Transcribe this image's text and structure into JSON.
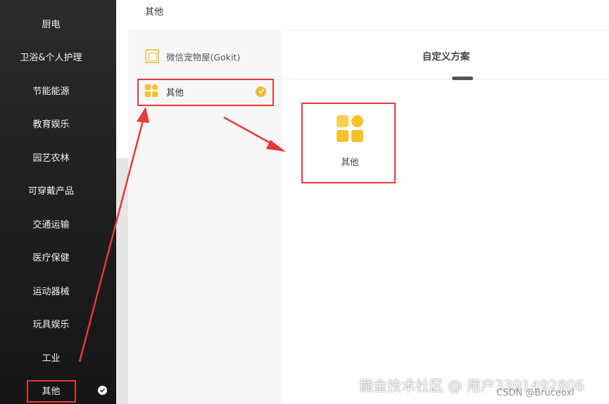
{
  "categories": {
    "items": [
      {
        "label": "厨电"
      },
      {
        "label": "卫浴&个人护理"
      },
      {
        "label": "节能能源"
      },
      {
        "label": "教育娱乐"
      },
      {
        "label": "园艺农林"
      },
      {
        "label": "可穿戴产品"
      },
      {
        "label": "交通运输"
      },
      {
        "label": "医疗保健"
      },
      {
        "label": "运动器械"
      },
      {
        "label": "玩具娱乐"
      },
      {
        "label": "工业"
      },
      {
        "label": "其他",
        "selected": true
      }
    ]
  },
  "header": {
    "title": "其他"
  },
  "products": [
    {
      "label": "微信宠物屋(Gokit)",
      "icon": "device-frame-icon"
    },
    {
      "label": "其他",
      "icon": "grid-apps-icon",
      "selected": true
    }
  ],
  "solution": {
    "tab_label": "自定义方案",
    "card_label": "其他",
    "card_icon": "grid-apps-icon"
  },
  "watermark": {
    "main": "掘金技术社区 @ 用户3391492806",
    "sub": "CSDN @Bruceoxl"
  },
  "colors": {
    "accent_yellow": "#f6c12b",
    "annotation_red": "#e5393b",
    "sidebar_bg": "#1f1f1f"
  }
}
